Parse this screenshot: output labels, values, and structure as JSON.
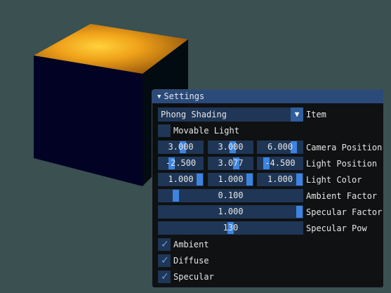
{
  "window": {
    "title": "Settings"
  },
  "item_combo": {
    "value": "Phong Shading",
    "label": "Item"
  },
  "movable_light": {
    "label": "Movable Light",
    "checked": false
  },
  "camera_position": {
    "label": "Camera Position",
    "values": [
      "3.000",
      "3.000",
      "6.000"
    ],
    "fractions": [
      0.55,
      0.55,
      0.85
    ]
  },
  "light_position": {
    "label": "Light Position",
    "values": [
      "-2.500",
      "3.077",
      "-4.500"
    ],
    "fractions": [
      0.25,
      0.65,
      0.15
    ]
  },
  "light_color": {
    "label": "Light Color",
    "values": [
      "1.000",
      "1.000",
      "1.000"
    ],
    "fractions": [
      1.0,
      1.0,
      1.0
    ]
  },
  "ambient_factor": {
    "label": "Ambient Factor",
    "value": "0.100",
    "fraction": 0.1
  },
  "specular_factor": {
    "label": "Specular Factor",
    "value": "1.000",
    "fraction": 1.0
  },
  "specular_pow": {
    "label": "Specular Pow",
    "value": "130",
    "fraction": 0.5
  },
  "checkboxes": [
    {
      "label": "Ambient",
      "checked": true
    },
    {
      "label": "Diffuse",
      "checked": true
    },
    {
      "label": "Specular",
      "checked": true
    }
  ],
  "icons": {
    "collapse": "triangle-down-icon",
    "combo": "triangle-down-icon",
    "check": "checkmark-icon"
  },
  "colors": {
    "background": "#3a5051",
    "title_bar": "#2a4a7a",
    "frame": "#1f3656",
    "grab": "#3d84e0",
    "check": "#5aa0f0"
  }
}
